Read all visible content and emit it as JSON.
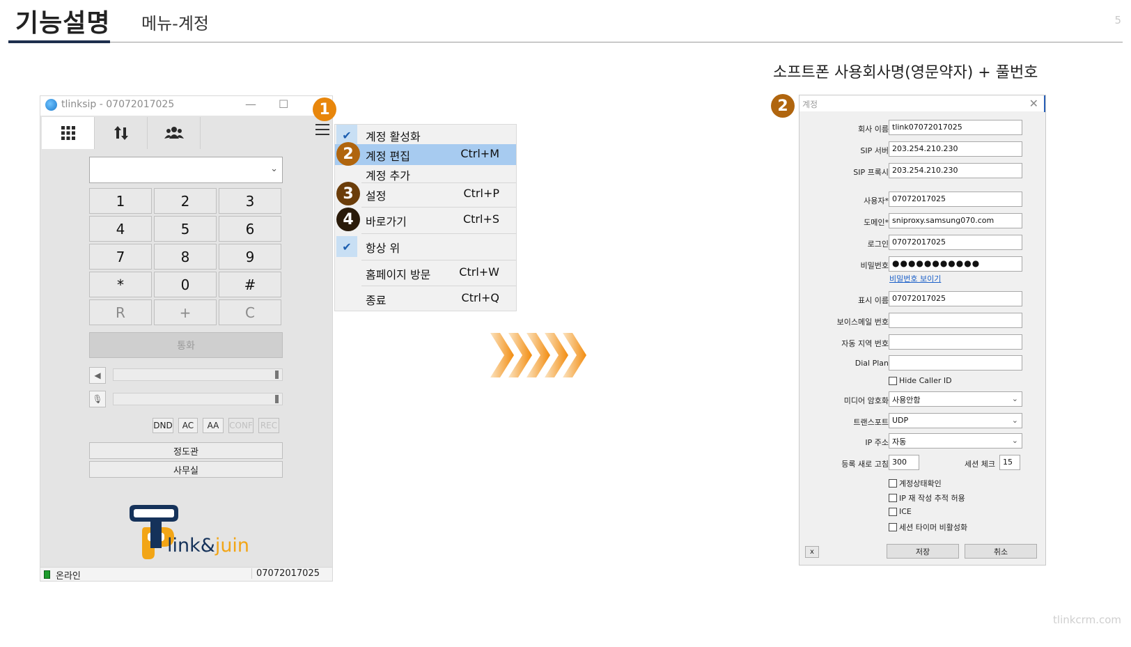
{
  "slide": {
    "title": "기능설명",
    "subtitle": "메뉴-계정",
    "page_number": "5",
    "footer": "tlinkcrm.com",
    "annotation": "소프트폰 사용회사명(영문약자) + 풀번호"
  },
  "badges": [
    "1",
    "2",
    "3",
    "4",
    "2"
  ],
  "colors": {
    "accent_navy": "#1e2f4d",
    "badge_orange": "#e8860b",
    "menu_highlight": "#a7cbf0",
    "arrow_orange": "#f28c0f",
    "brand_navy": "#15325a",
    "brand_yellow": "#f2a516"
  },
  "phone": {
    "title": "tlinksip - 07072017025",
    "win_minimize": "—",
    "win_maximize": "☐",
    "tabs": [
      "dialpad-icon",
      "transfer-icon",
      "contacts-icon"
    ],
    "chev": "⌄",
    "keys": [
      "1",
      "2",
      "3",
      "4",
      "5",
      "6",
      "7",
      "8",
      "9",
      "*",
      "0",
      "#",
      "R",
      "+",
      "C"
    ],
    "call_label": "통화",
    "speaker_icon": "◀",
    "mic_icon": "🎙",
    "buttons": [
      "DND",
      "AC",
      "AA",
      "CONF",
      "REC"
    ],
    "list_buttons": [
      "정도관",
      "사무실"
    ],
    "brand": {
      "part1": "link&",
      "part2": "juin"
    },
    "status": {
      "state": "온라인",
      "number": "07072017025"
    }
  },
  "menu": {
    "items": [
      {
        "label": "계정 활성화",
        "shortcut": "",
        "checked": true
      },
      {
        "label": "계정 편집",
        "shortcut": "Ctrl+M",
        "checked": false
      },
      {
        "label": "계정 추가",
        "shortcut": "",
        "checked": false
      },
      {
        "label": "설정",
        "shortcut": "Ctrl+P",
        "checked": false
      },
      {
        "label": "바로가기",
        "shortcut": "Ctrl+S",
        "checked": false
      },
      {
        "label": "항상 위",
        "shortcut": "",
        "checked": true
      },
      {
        "label": "홈페이지 방문",
        "shortcut": "Ctrl+W",
        "checked": false
      },
      {
        "label": "종료",
        "shortcut": "Ctrl+Q",
        "checked": false
      }
    ],
    "check_glyph": "✔"
  },
  "dialog": {
    "title": "계정",
    "close": "✕",
    "fields": {
      "company_label": "회사 이름",
      "company": "tlink07072017025",
      "sip_server_label": "SIP 서버",
      "sip_server": "203.254.210.230",
      "sip_proxy_label": "SIP 프록시",
      "sip_proxy": "203.254.210.230",
      "user_label": "사용자*",
      "user": "07072017025",
      "domain_label": "도메인*",
      "domain": "sniproxy.samsung070.com",
      "login_label": "로그인",
      "login": "07072017025",
      "password_label": "비밀번호",
      "password": "●●●●●●●●●●●",
      "show_password": "비밀번호 보이기",
      "display_label": "표시 이름",
      "display": "07072017025",
      "voicemail_label": "보이스메일 번호",
      "voicemail": "",
      "area_label": "자동 지역 번호",
      "area": "",
      "dialplan_label": "Dial Plan",
      "dialplan": "",
      "hide_caller": "Hide Caller ID",
      "media_label": "미디어 암호화",
      "media": "사용안함",
      "transport_label": "트랜스포트",
      "transport": "UDP",
      "ip_label": "IP 주소",
      "ip": "자동",
      "refresh_label": "등록 새로 고침",
      "refresh": "300",
      "session_label": "세션 체크",
      "session": "15",
      "cb1": "계정상태확인",
      "cb2": "IP 재 작성 추적 허용",
      "cb3": "ICE",
      "cb4": "세션 타이머 비활성화",
      "select_arrow": "⌄"
    },
    "x_button": "x",
    "save": "저장",
    "cancel": "취소"
  }
}
